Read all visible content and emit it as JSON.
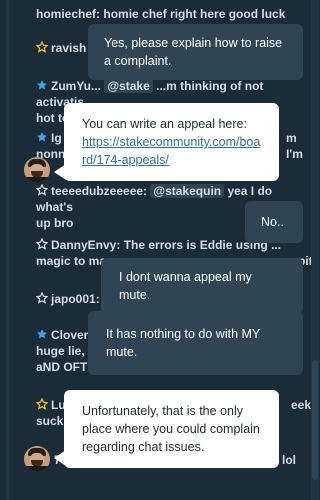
{
  "chat": {
    "messages": [
      {
        "user": "homiechef:",
        "text": "homie chef right here good luck",
        "star": "none"
      },
      {
        "user": "ravish",
        "text": "",
        "star": "gold"
      },
      {
        "user": "ZumYu...",
        "mention": "@stake",
        "text": "...m thinking of not activatis",
        "text2": "hot today",
        "star": "blue"
      },
      {
        "user": "Ig",
        "text": "m I'm",
        "text2": "nonn",
        "star": "blue"
      },
      {
        "user": "teeeedubzeeeee:",
        "mention": "@stakequin",
        "text": "yea I do what's",
        "text2": "up bro",
        "star": "outline"
      },
      {
        "user": "DannyEnvy:",
        "text": "The errors is Eddie using ...",
        "text2": "magic to ma",
        "text3": "pit",
        "star": "outline"
      },
      {
        "user": "japo001:",
        "text": "",
        "star": "outline"
      },
      {
        "user": "Clover",
        "text": "",
        "text2": "huge lie,",
        "text3": "aND OFT",
        "star": "blue"
      },
      {
        "user": "Lu",
        "text": "eek",
        "text2": "suck",
        "star": "gold"
      },
      {
        "user": "7c",
        "text": "e lol",
        "star": "none"
      }
    ]
  },
  "bubbles": {
    "b1": "Yes, please explain how to raise a complaint.",
    "b2_prefix": "You can write an appeal here:",
    "b2_link": "https://stakecommunity.com/board/174-appeals/",
    "b3": "No..",
    "b4": "I dont wanna appeal my mute.",
    "b5": "It has nothing to do with MY mute.",
    "b6": "Unfortunately, that is the only place where you could complain regarding chat issues."
  },
  "colors": {
    "background": "#1a2c38",
    "bubble_dark": "#2f4553",
    "bubble_light": "#ffffff",
    "star_gold": "#e8c11c",
    "star_blue": "#38a5f0",
    "link": "#2f6fb0"
  }
}
